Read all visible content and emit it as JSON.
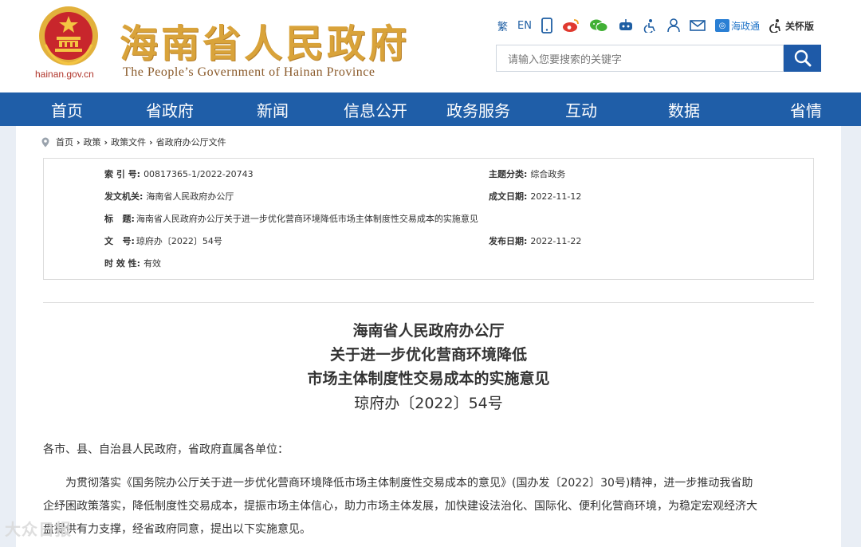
{
  "header": {
    "site_title": "海南省人民政府",
    "site_subtitle": "The People’s Government  of Hainan Province",
    "domain": "hainan.gov.cn",
    "toolbar": {
      "traditional": "繁",
      "english": "EN",
      "haizhengtong": "海政通",
      "elder_care": "关怀版"
    },
    "search": {
      "placeholder": "请输入您要搜索的关键字"
    }
  },
  "nav": {
    "items": [
      "首页",
      "省政府",
      "新闻",
      "信息公开",
      "政务服务",
      "互动",
      "数据",
      "省情"
    ]
  },
  "breadcrumb": [
    "首页",
    "政策",
    "政策文件",
    "省政府办公厅文件"
  ],
  "meta": {
    "index_label": "索 引 号:",
    "index_value": "00817365-1/2022-20743",
    "topic_label": "主题分类:",
    "topic_value": "综合政务",
    "issuer_label": "发文机关:",
    "issuer_value": "海南省人民政府办公厅",
    "written_label": "成文日期:",
    "written_value": "2022-11-12",
    "title_label": "标   题:",
    "title_value": "海南省人民政府办公厅关于进一步优化营商环境降低市场主体制度性交易成本的实施意见",
    "doc_no_label": "文   号:",
    "doc_no_value": "琼府办〔2022〕54号",
    "publish_label": "发布日期:",
    "publish_value": "2022-11-22",
    "validity_label": "时 效 性:",
    "validity_value": "有效"
  },
  "document": {
    "title_line1": "海南省人民政府办公厅",
    "title_line2": "关于进一步优化营商环境降低",
    "title_line3": "市场主体制度性交易成本的实施意见",
    "number": "琼府办〔2022〕54号",
    "salutation": "各市、县、自治县人民政府，省政府直属各单位：",
    "body_line1": "为贯彻落实《国务院办公厅关于进一步优化营商环境降低市场主体制度性交易成本的意见》(国办发〔2022〕30号)精神，进一步推动我省助",
    "body_line2": "企纾困政策落实，降低制度性交易成本，提振市场主体信心，助力市场主体发展，加快建设法治化、国际化、便利化营商环境，为稳定宏观经济大",
    "body_line3": "盘提供有力支撑，经省政府同意，提出以下实施意见。"
  },
  "watermark": "大众日报",
  "colors": {
    "nav_blue": "#1f5ea8",
    "title_gold": "#d9a33a",
    "emblem_red": "#c8262c"
  }
}
